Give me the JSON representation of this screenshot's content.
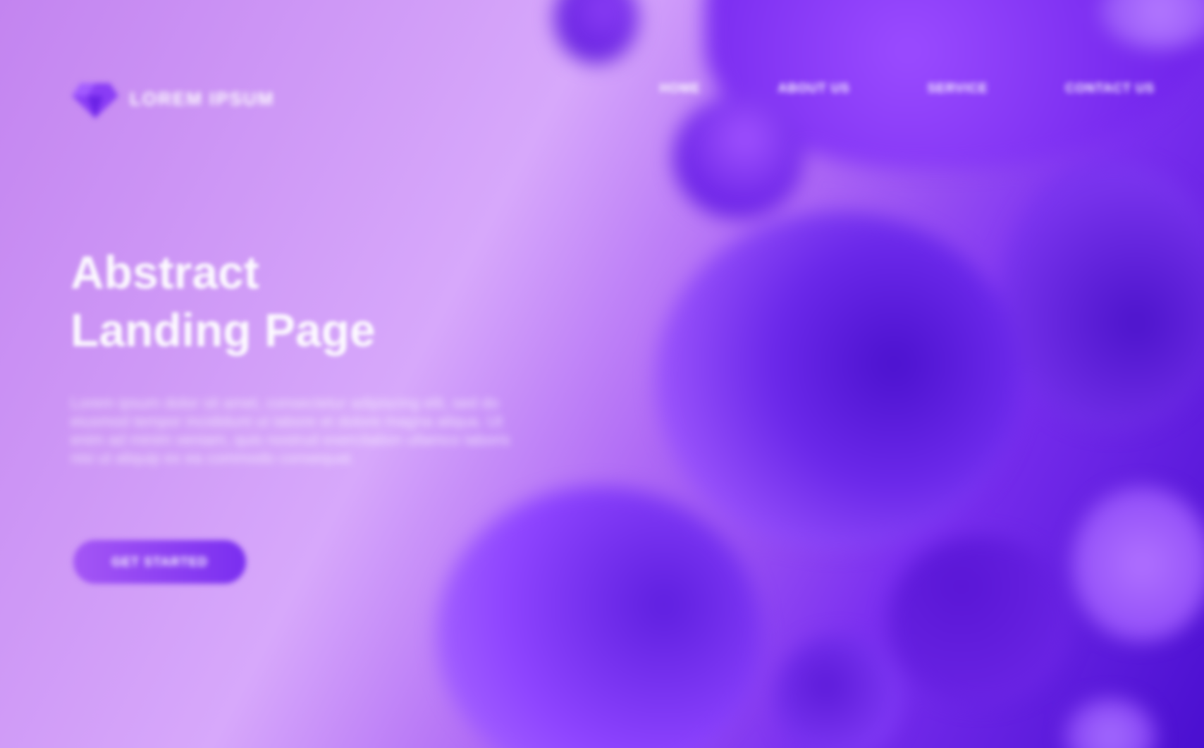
{
  "brand": {
    "logo_text": "LOREM IPSUM",
    "logo_icon": "gem-icon"
  },
  "nav": {
    "items": [
      {
        "label": "HOME"
      },
      {
        "label": "ABOUT US"
      },
      {
        "label": "SERVICE"
      },
      {
        "label": "CONTACT US"
      }
    ]
  },
  "hero": {
    "title_line1": "Abstract",
    "title_line2": "Landing Page",
    "description": "Lorem ipsum dolor sit amet, consectetur adipiscing elit, sed do eiusmod tempor incididunt ut labore et dolore magna aliqua. Ut enim ad minim veniam, quis nostrud exercitation ullamco laboris nisi ut aliquip ex ea commodo consequat.",
    "cta_label": "GET STARTED"
  },
  "colors": {
    "accent": "#8a3df5",
    "dark_purple": "#4a0fd0",
    "light_lilac": "#d7a8fb"
  }
}
